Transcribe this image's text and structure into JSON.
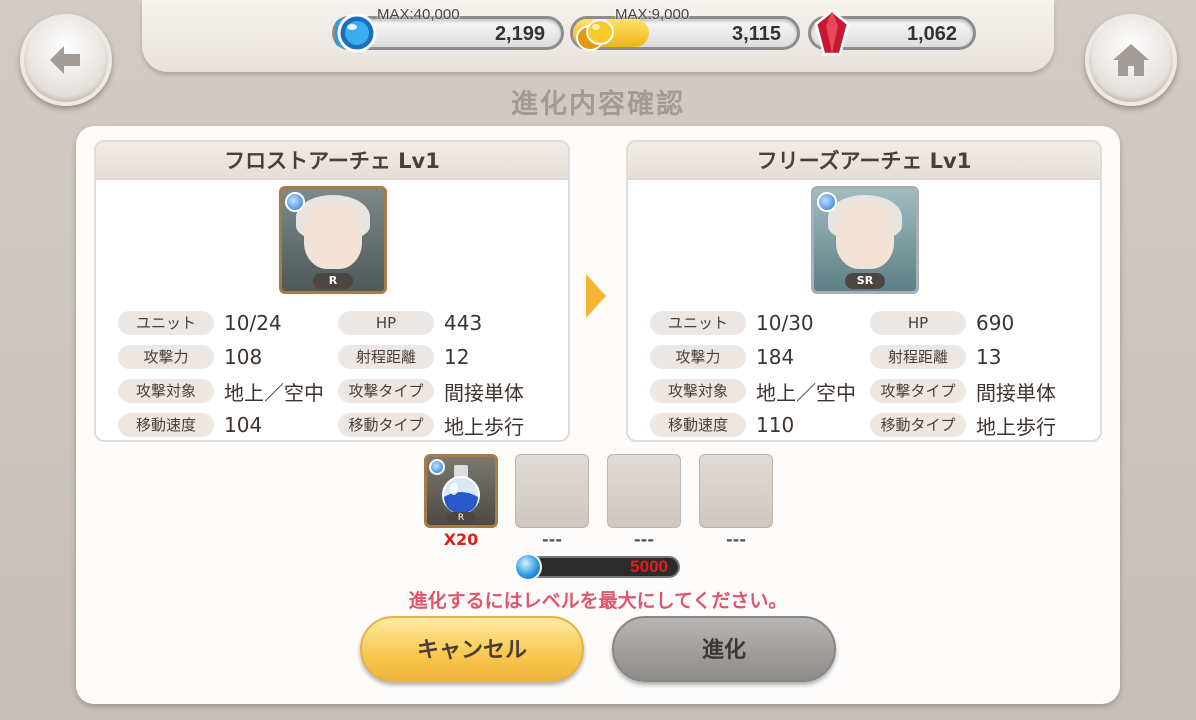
{
  "header": {
    "currencies": [
      {
        "name": "crystal",
        "max_label": "MAX:40,000",
        "value": "2,199",
        "fill": 0.05,
        "color": "#2f9be0"
      },
      {
        "name": "gold",
        "max_label": "MAX:9,000",
        "value": "3,115",
        "fill": 0.35,
        "color": "#f3c22b"
      },
      {
        "name": "gem",
        "max_label": "",
        "value": "1,062",
        "fill": 0,
        "color": "#d1243a"
      }
    ]
  },
  "title": "進化内容確認",
  "before": {
    "name": "フロストアーチェ Lv1",
    "rarity": "R",
    "stats": [
      {
        "label": "ユニット",
        "value": "10/24"
      },
      {
        "label": "HP",
        "value": "443"
      },
      {
        "label": "攻撃力",
        "value": "108"
      },
      {
        "label": "射程距離",
        "value": "12"
      },
      {
        "label": "攻撃対象",
        "value": "地上／空中"
      },
      {
        "label": "攻撃タイプ",
        "value": "間接単体"
      },
      {
        "label": "移動速度",
        "value": "104"
      },
      {
        "label": "移動タイプ",
        "value": "地上歩行"
      }
    ]
  },
  "after": {
    "name": "フリーズアーチェ Lv1",
    "rarity": "SR",
    "stats": [
      {
        "label": "ユニット",
        "value": "10/30"
      },
      {
        "label": "HP",
        "value": "690"
      },
      {
        "label": "攻撃力",
        "value": "184"
      },
      {
        "label": "射程距離",
        "value": "13"
      },
      {
        "label": "攻撃対象",
        "value": "地上／空中"
      },
      {
        "label": "攻撃タイプ",
        "value": "間接単体"
      },
      {
        "label": "移動速度",
        "value": "110"
      },
      {
        "label": "移動タイプ",
        "value": "地上歩行"
      }
    ]
  },
  "materials": [
    {
      "count": "X20",
      "rarity": "R"
    },
    {
      "count": "---"
    },
    {
      "count": "---"
    },
    {
      "count": "---"
    }
  ],
  "cost": "5000",
  "warning": "進化するにはレベルを最大にしてください。",
  "buttons": {
    "cancel": "キャンセル",
    "evolve": "進化"
  }
}
